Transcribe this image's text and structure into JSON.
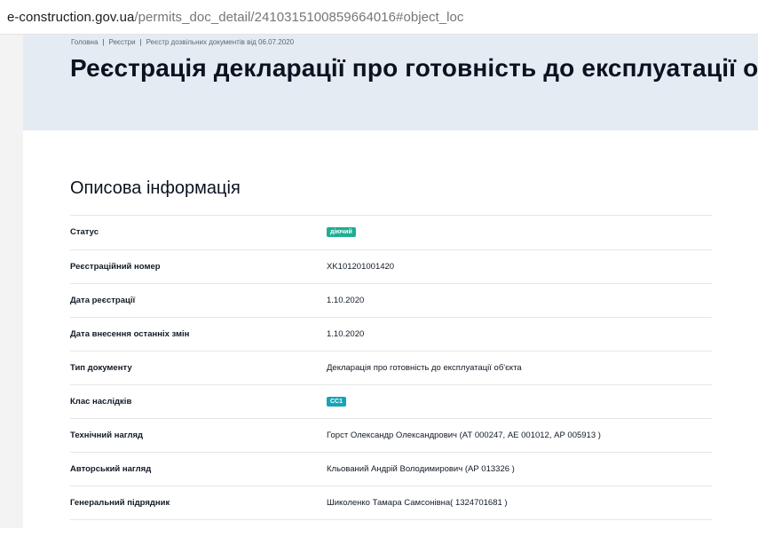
{
  "browser": {
    "url_host": "e-construction.gov.ua",
    "url_path": "/permits_doc_detail/2410315100859664016#object_loc"
  },
  "breadcrumb": [
    {
      "label": "Головна"
    },
    {
      "label": "Реєстри"
    },
    {
      "label": "Реєстр дозвільних документів від 06.07.2020"
    }
  ],
  "breadcrumb_separator": "|",
  "page": {
    "title": "Реєстрація декларації про готовність до експлуатації о"
  },
  "section": {
    "title": "Описова інформація"
  },
  "colors": {
    "status_badge": "#1fae92",
    "class_badge": "#17a3b8",
    "hero_background": "#e5ebf2"
  },
  "info": {
    "status": {
      "label": "Статус",
      "badge": "діючий"
    },
    "reg_number": {
      "label": "Реєстраційний номер",
      "value": "XK101201001420"
    },
    "reg_date": {
      "label": "Дата реєстрації",
      "value": "1.10.2020"
    },
    "last_change": {
      "label": "Дата внесення останніх змін",
      "value": "1.10.2020"
    },
    "doc_type": {
      "label": "Тип документу",
      "value": "Декларація про готовність до експлуатації об'єкта"
    },
    "consequence_class": {
      "label": "Клас наслідків",
      "badge": "СС1"
    },
    "tech_supervision": {
      "label": "Технічний нагляд",
      "value": "Горст Олександр Олександрович (АТ 000247, АЕ 001012, АР 005913 )"
    },
    "author_supervision": {
      "label": "Авторський нагляд",
      "value": "Кльований Андрій Володимирович (АР 013326 )"
    },
    "general_contractor": {
      "label": "Генеральний підрядник",
      "value": "Шиколенко Тамара Самсонівна( 1324701681 )"
    }
  }
}
